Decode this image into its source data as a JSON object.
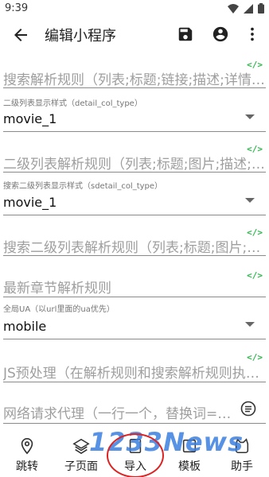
{
  "status": {
    "time": "9:39"
  },
  "app_bar": {
    "title": "编辑小程序"
  },
  "fields": {
    "search_rule": {
      "placeholder": "搜索解析规则（列表;标题;链接;描述;详情;图片）"
    },
    "second_list_rule": {
      "placeholder": "二级列表解析规则（列表;标题;图片;描述;链接）"
    },
    "search_second_rule": {
      "placeholder": "搜索二级列表解析规则（列表;标题;图片;描述;链接）"
    },
    "latest_chapter_rule": {
      "placeholder": "最新章节解析规则"
    },
    "js_preprocess": {
      "placeholder": "JS预处理（在解析规则和搜索解析规则执行前运行）"
    },
    "proxy": {
      "placeholder": "网络请求代理（一行一个，替换词=>替换成）"
    }
  },
  "code_tag": "</>",
  "selects": {
    "detail_col_type": {
      "label": "二级列表显示样式（detail_col_type）",
      "value": "movie_1"
    },
    "sdetail_col_type": {
      "label": "搜索二级列表显示样式（sdetail_col_type）",
      "value": "movie_1"
    },
    "global_ua": {
      "label": "全局UA（以url里面的ua优先）",
      "value": "mobile"
    }
  },
  "bottom_nav": {
    "items": [
      {
        "label": "跳转",
        "icon": "location-pin-icon"
      },
      {
        "label": "子页面",
        "icon": "layers-icon"
      },
      {
        "label": "导入",
        "icon": "import-icon"
      },
      {
        "label": "模板",
        "icon": "template-icon"
      },
      {
        "label": "助手",
        "icon": "assistant-icon"
      }
    ]
  },
  "watermark": "1233News",
  "colors": {
    "code_tag": "#2db84c",
    "watermark": "#3b7fe0",
    "highlight": "#dd2222"
  }
}
